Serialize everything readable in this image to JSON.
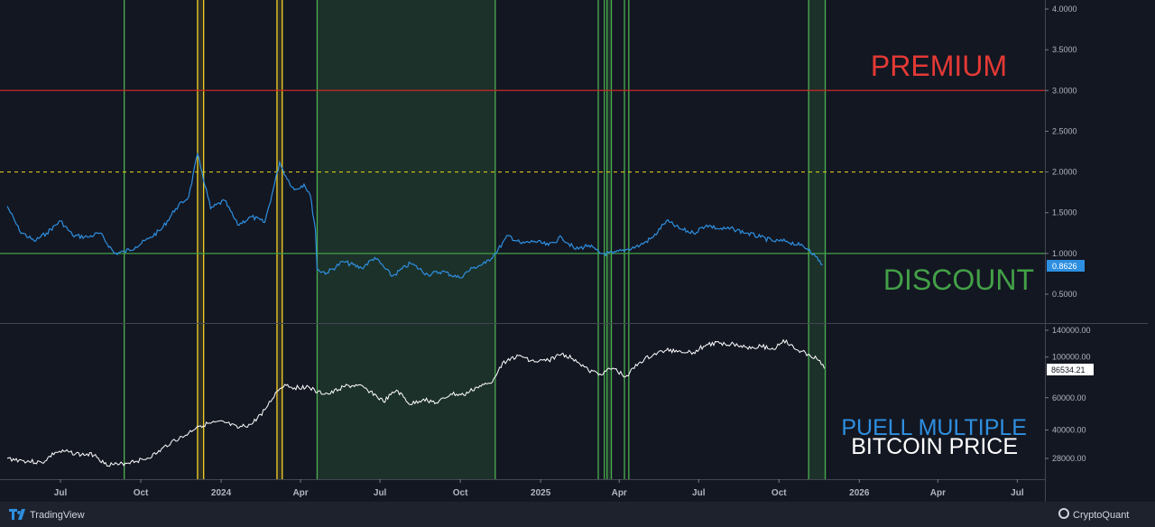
{
  "colors": {
    "background": "#131722",
    "footer": "#1e222d",
    "puell_line": "#2e8fe0",
    "price_line": "#ffffff",
    "premium": "#e53935",
    "discount": "#43a047",
    "yellow_band": "#f5d327",
    "green_band": "#4caf50"
  },
  "labels": {
    "premium": "PREMIUM",
    "discount": "DISCOUNT",
    "puell": "PUELL MULTIPLE",
    "price": "BITCOIN PRICE"
  },
  "footer": {
    "left_brand": "TradingView",
    "right_brand": "CryptoQuant"
  },
  "chart_data": {
    "type": "line",
    "x_axis": {
      "ticks": [
        "Jul",
        "Oct",
        "2024",
        "Apr",
        "Jul",
        "Oct",
        "2025",
        "Apr",
        "Jul",
        "Oct",
        "2026",
        "Apr",
        "Jul"
      ],
      "range": [
        "2023-05-01",
        "2026-08-31"
      ]
    },
    "bands": [
      {
        "type": "line",
        "color": "green",
        "date": "2023-09-12"
      },
      {
        "type": "band",
        "color": "yellow",
        "start": "2023-12-05",
        "end": "2023-12-12"
      },
      {
        "type": "band",
        "color": "yellow",
        "start": "2024-03-05",
        "end": "2024-03-11"
      },
      {
        "type": "band",
        "color": "green",
        "start": "2024-04-20",
        "end": "2024-11-10"
      },
      {
        "type": "line",
        "color": "green",
        "date": "2025-03-08"
      },
      {
        "type": "line",
        "color": "green",
        "date": "2025-03-15"
      },
      {
        "type": "band",
        "color": "green",
        "start": "2025-03-18",
        "end": "2025-03-23"
      },
      {
        "type": "line",
        "color": "green",
        "date": "2025-04-07"
      },
      {
        "type": "line",
        "color": "green",
        "date": "2025-04-12"
      },
      {
        "type": "band",
        "color": "green",
        "start": "2025-11-04",
        "end": "2025-11-23"
      }
    ],
    "panels": [
      {
        "name": "PUELL MULTIPLE",
        "ylim": [
          0.3,
          4.0
        ],
        "y_ticks": [
          "0.5000",
          "1.0000",
          "1.5000",
          "2.0000",
          "2.5000",
          "3.0000",
          "3.5000",
          "4.0000"
        ],
        "y_tick_values": [
          0.5,
          1.0,
          1.5,
          2.0,
          2.5,
          3.0,
          3.5,
          4.0
        ],
        "reference_lines": [
          {
            "value": 3.0,
            "style": "solid",
            "color": "red"
          },
          {
            "value": 2.0,
            "style": "dashed",
            "color": "yellow"
          },
          {
            "value": 1.0,
            "style": "solid",
            "color": "green"
          }
        ],
        "last_value_label": "0.8626",
        "series": [
          {
            "x": [
              "2023-05-01",
              "2023-05-15",
              "2023-06-01",
              "2023-06-15",
              "2023-07-01",
              "2023-07-15",
              "2023-08-01",
              "2023-08-15",
              "2023-09-01",
              "2023-09-12",
              "2023-09-25",
              "2023-10-10",
              "2023-10-25",
              "2023-11-10",
              "2023-11-25",
              "2023-12-05",
              "2023-12-10",
              "2023-12-20",
              "2024-01-05",
              "2024-01-20",
              "2024-02-05",
              "2024-02-20",
              "2024-03-01",
              "2024-03-08",
              "2024-03-15",
              "2024-03-25",
              "2024-04-05",
              "2024-04-12",
              "2024-04-18",
              "2024-04-20",
              "2024-05-01",
              "2024-05-20",
              "2024-06-10",
              "2024-06-25",
              "2024-07-15",
              "2024-08-05",
              "2024-08-25",
              "2024-09-10",
              "2024-09-30",
              "2024-10-15",
              "2024-10-30",
              "2024-11-10",
              "2024-11-25",
              "2024-12-10",
              "2024-12-25",
              "2025-01-10",
              "2025-01-25",
              "2025-02-10",
              "2025-02-25",
              "2025-03-10",
              "2025-03-25",
              "2025-04-10",
              "2025-04-25",
              "2025-05-10",
              "2025-05-25",
              "2025-06-10",
              "2025-06-25",
              "2025-07-10",
              "2025-07-25",
              "2025-08-10",
              "2025-08-25",
              "2025-09-10",
              "2025-09-25",
              "2025-10-10",
              "2025-10-25",
              "2025-11-05",
              "2025-11-12",
              "2025-11-20"
            ],
            "values": [
              1.58,
              1.28,
              1.15,
              1.25,
              1.4,
              1.22,
              1.2,
              1.25,
              1.0,
              1.02,
              1.08,
              1.18,
              1.3,
              1.55,
              1.7,
              2.22,
              2.0,
              1.55,
              1.65,
              1.35,
              1.45,
              1.38,
              1.8,
              2.12,
              1.95,
              1.78,
              1.85,
              1.72,
              1.3,
              0.8,
              0.76,
              0.9,
              0.82,
              0.95,
              0.72,
              0.88,
              0.74,
              0.78,
              0.7,
              0.82,
              0.88,
              1.0,
              1.22,
              1.12,
              1.15,
              1.1,
              1.2,
              1.05,
              1.1,
              1.0,
              1.0,
              1.05,
              1.1,
              1.2,
              1.4,
              1.3,
              1.25,
              1.35,
              1.3,
              1.3,
              1.25,
              1.2,
              1.15,
              1.15,
              1.1,
              1.05,
              0.96,
              0.86
            ]
          }
        ]
      },
      {
        "name": "BITCOIN PRICE",
        "ylim": [
          20000,
          150000
        ],
        "scale": "log",
        "y_ticks": [
          "28000.00",
          "40000.00",
          "60000.00",
          "100000.00",
          "140000.00"
        ],
        "y_tick_values": [
          28000,
          40000,
          60000,
          100000,
          140000
        ],
        "last_value_label": "86534.21",
        "series": [
          {
            "x": [
              "2023-05-01",
              "2023-05-20",
              "2023-06-10",
              "2023-06-25",
              "2023-07-10",
              "2023-07-25",
              "2023-08-10",
              "2023-08-20",
              "2023-09-05",
              "2023-09-20",
              "2023-10-05",
              "2023-10-20",
              "2023-11-05",
              "2023-11-20",
              "2023-12-05",
              "2023-12-20",
              "2024-01-05",
              "2024-01-20",
              "2024-02-05",
              "2024-02-20",
              "2024-03-05",
              "2024-03-14",
              "2024-03-25",
              "2024-04-10",
              "2024-04-20",
              "2024-05-05",
              "2024-05-20",
              "2024-06-05",
              "2024-06-20",
              "2024-07-05",
              "2024-07-20",
              "2024-08-05",
              "2024-08-20",
              "2024-09-05",
              "2024-09-20",
              "2024-10-05",
              "2024-10-20",
              "2024-11-05",
              "2024-11-15",
              "2024-11-25",
              "2024-12-10",
              "2024-12-25",
              "2025-01-10",
              "2025-01-25",
              "2025-02-10",
              "2025-02-25",
              "2025-03-10",
              "2025-03-25",
              "2025-04-08",
              "2025-04-25",
              "2025-05-10",
              "2025-05-25",
              "2025-06-10",
              "2025-06-25",
              "2025-07-10",
              "2025-07-25",
              "2025-08-10",
              "2025-08-25",
              "2025-09-10",
              "2025-09-25",
              "2025-10-06",
              "2025-10-20",
              "2025-11-05",
              "2025-11-15",
              "2025-11-22"
            ],
            "values": [
              28000,
              27200,
              26500,
              30200,
              30400,
              29300,
              29400,
              26200,
              25800,
              26900,
              27600,
              30000,
              34500,
              37000,
              42000,
              43500,
              44000,
              41000,
              43000,
              51500,
              65000,
              71000,
              68000,
              69000,
              64000,
              63000,
              69000,
              70000,
              65000,
              57000,
              66000,
              55000,
              59000,
              56000,
              63000,
              62000,
              68500,
              72000,
              88000,
              98000,
              101000,
              94000,
              96000,
              104000,
              97000,
              84000,
              81000,
              87000,
              78000,
              94000,
              103000,
              109000,
              108000,
              106000,
              117000,
              119000,
              118000,
              113000,
              115000,
              110000,
              124000,
              110000,
              103000,
              96000,
              86534
            ]
          }
        ]
      }
    ]
  }
}
